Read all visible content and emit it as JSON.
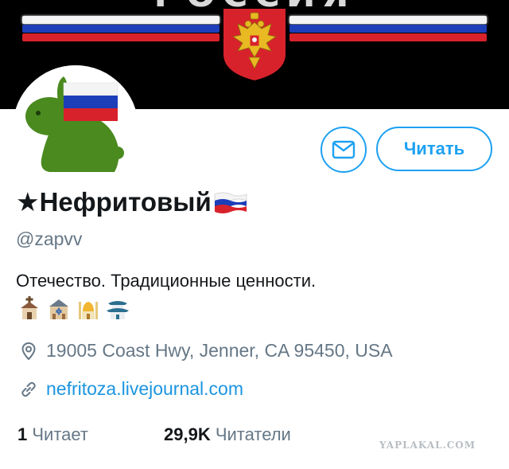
{
  "banner": {
    "text": "РОССИЯ"
  },
  "profile": {
    "name": "★Нефритовый",
    "handle": "@zapvv",
    "bio": "Отечество. Традиционные ценности.",
    "bio_icons": [
      "church-icon",
      "synagogue-icon",
      "mosque-icon",
      "temple-icon"
    ],
    "location": "19005 Coast Hwy, Jenner, CA 95450, USA",
    "website": "nefritoza.livejournal.com"
  },
  "actions": {
    "message_icon": "envelope-icon",
    "follow_label": "Читать"
  },
  "stats": {
    "following_count": "1",
    "following_label": "Читает",
    "followers_count": "29,9K",
    "followers_label": "Читатели"
  },
  "watermark": "YAPLAKAL.COM",
  "colors": {
    "accent": "#1da1f2",
    "link": "#1b95e0",
    "muted": "#657786",
    "text": "#14171a",
    "avatar_rabbit": "#4a8a1f"
  }
}
